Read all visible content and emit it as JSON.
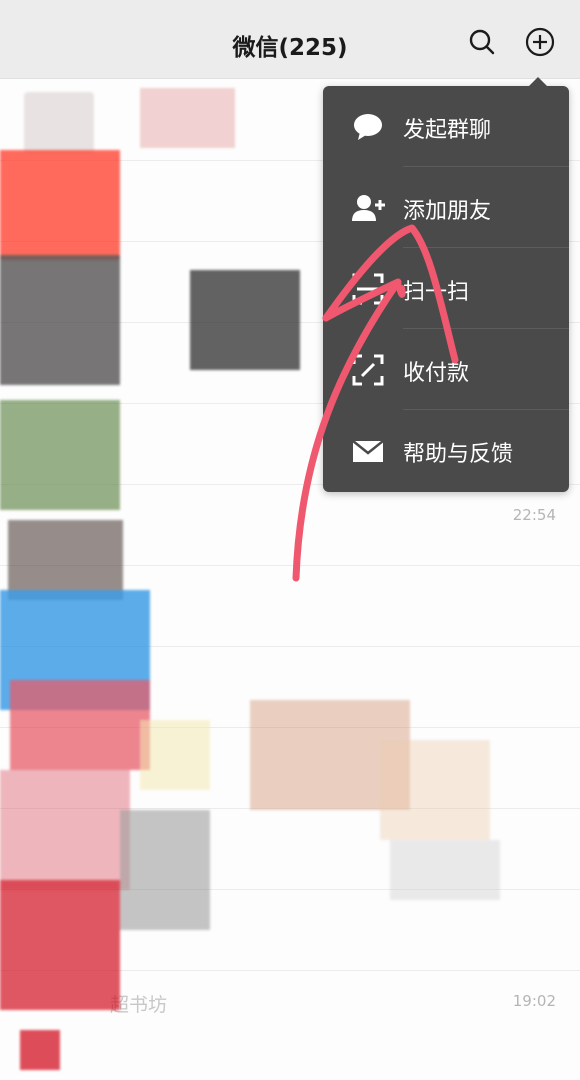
{
  "header": {
    "title": "微信(225)",
    "search_icon": "search-icon",
    "add_icon": "plus-circle-icon"
  },
  "menu": {
    "items": [
      {
        "label": "发起群聊",
        "icon": "chat-bubble-icon"
      },
      {
        "label": "添加朋友",
        "icon": "add-friend-icon"
      },
      {
        "label": "扫一扫",
        "icon": "scan-icon"
      },
      {
        "label": "收付款",
        "icon": "payment-icon"
      },
      {
        "label": "帮助与反馈",
        "icon": "mail-icon"
      }
    ]
  },
  "chats": [
    {
      "name": "",
      "time": ""
    },
    {
      "name": "",
      "time": ""
    },
    {
      "name": "",
      "time": ""
    },
    {
      "name": "",
      "time": ""
    },
    {
      "name": "",
      "time": ""
    },
    {
      "name": "",
      "time": "22:54"
    },
    {
      "name": "",
      "time": ""
    },
    {
      "name": "",
      "time": ""
    },
    {
      "name": "",
      "time": ""
    },
    {
      "name": "",
      "time": ""
    },
    {
      "name": "",
      "time": ""
    },
    {
      "name": "超书坊",
      "time": "19:02"
    }
  ],
  "colors": {
    "header_bg": "#ececec",
    "menu_bg": "#4a4a4a",
    "annotation_stroke": "#f0586f"
  }
}
